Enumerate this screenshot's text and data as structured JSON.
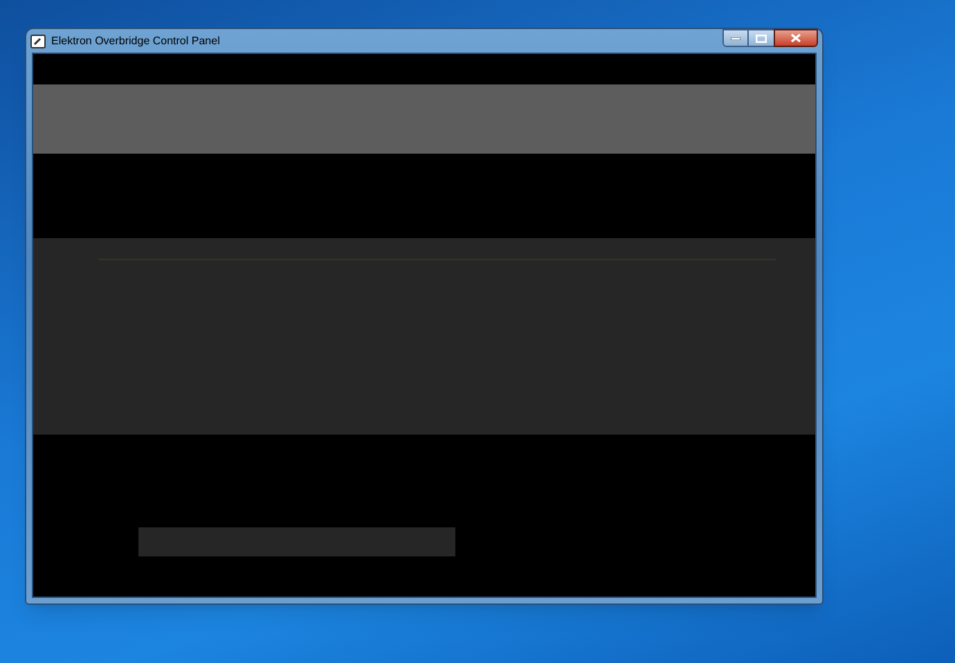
{
  "window": {
    "title": "Elektron Overbridge Control Panel"
  }
}
